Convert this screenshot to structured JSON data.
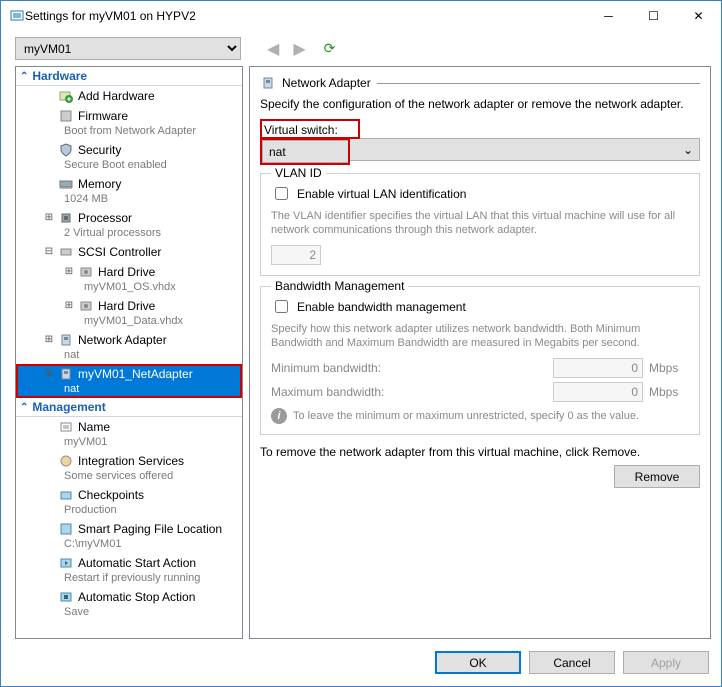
{
  "window": {
    "title": "Settings for myVM01 on HYPV2"
  },
  "vm_selector": {
    "value": "myVM01"
  },
  "tree": {
    "hardware_header": "Hardware",
    "management_header": "Management",
    "add_hardware": "Add Hardware",
    "firmware": {
      "label": "Firmware",
      "sub": "Boot from Network Adapter"
    },
    "security": {
      "label": "Security",
      "sub": "Secure Boot enabled"
    },
    "memory": {
      "label": "Memory",
      "sub": "1024 MB"
    },
    "processor": {
      "label": "Processor",
      "sub": "2 Virtual processors"
    },
    "scsi": {
      "label": "SCSI Controller"
    },
    "hd1": {
      "label": "Hard Drive",
      "sub": "myVM01_OS.vhdx"
    },
    "hd2": {
      "label": "Hard Drive",
      "sub": "myVM01_Data.vhdx"
    },
    "net1": {
      "label": "Network Adapter",
      "sub": "nat"
    },
    "net2": {
      "label": "myVM01_NetAdapter",
      "sub": "nat"
    },
    "name": {
      "label": "Name",
      "sub": "myVM01"
    },
    "integration": {
      "label": "Integration Services",
      "sub": "Some services offered"
    },
    "checkpoints": {
      "label": "Checkpoints",
      "sub": "Production"
    },
    "smartpaging": {
      "label": "Smart Paging File Location",
      "sub": "C:\\myVM01"
    },
    "autostart": {
      "label": "Automatic Start Action",
      "sub": "Restart if previously running"
    },
    "autostop": {
      "label": "Automatic Stop Action",
      "sub": "Save"
    }
  },
  "detail": {
    "title": "Network Adapter",
    "desc": "Specify the configuration of the network adapter or remove the network adapter.",
    "vswitch_label": "Virtual switch:",
    "vswitch_value": "nat",
    "vlan": {
      "legend": "VLAN ID",
      "checkbox": "Enable virtual LAN identification",
      "help": "The VLAN identifier specifies the virtual LAN that this virtual machine will use for all network communications through this network adapter.",
      "value": "2"
    },
    "bandwidth": {
      "legend": "Bandwidth Management",
      "checkbox": "Enable bandwidth management",
      "help": "Specify how this network adapter utilizes network bandwidth. Both Minimum Bandwidth and Maximum Bandwidth are measured in Megabits per second.",
      "min_label": "Minimum bandwidth:",
      "max_label": "Maximum bandwidth:",
      "min_value": "0",
      "max_value": "0",
      "unit": "Mbps",
      "info": "To leave the minimum or maximum unrestricted, specify 0 as the value."
    },
    "remove_text": "To remove the network adapter from this virtual machine, click Remove.",
    "remove_btn": "Remove"
  },
  "footer": {
    "ok": "OK",
    "cancel": "Cancel",
    "apply": "Apply"
  }
}
